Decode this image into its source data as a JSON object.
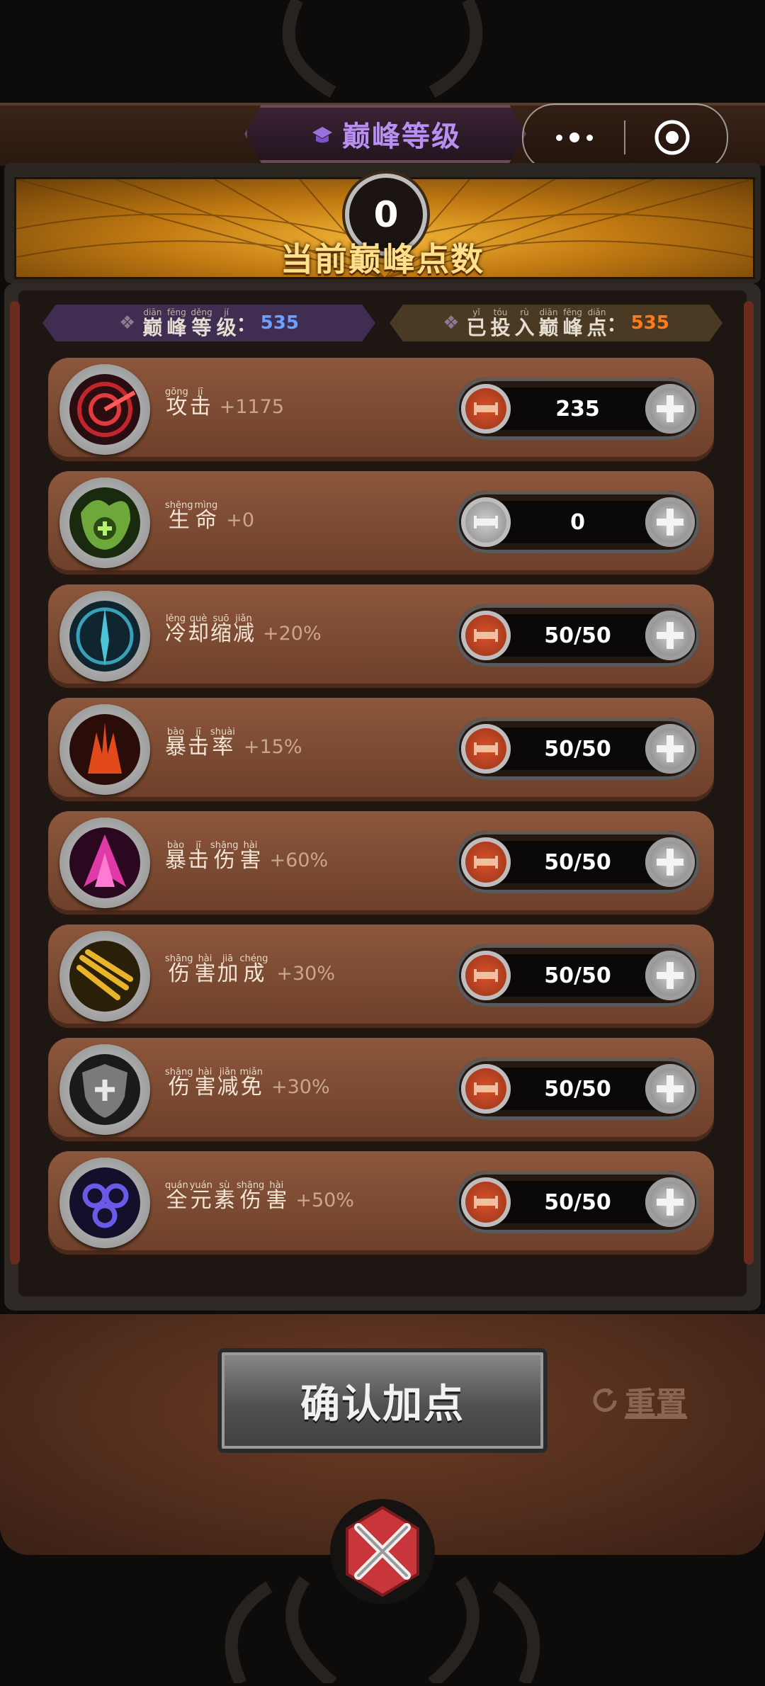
{
  "header": {
    "title": "巅峰等级",
    "title_icon": "peak-hat-icon",
    "capsule": {
      "more_icon": "more-dots-icon",
      "close_icon": "target-close-icon"
    }
  },
  "points": {
    "current": "0",
    "label": "当前巅峰点数"
  },
  "info": {
    "level": {
      "chars": [
        {
          "py": "diān",
          "hz": "巅"
        },
        {
          "py": "fēng",
          "hz": "峰"
        },
        {
          "py": "děng",
          "hz": "等"
        },
        {
          "py": "jí",
          "hz": "级"
        }
      ],
      "value": "535"
    },
    "invested": {
      "chars": [
        {
          "py": "yǐ",
          "hz": "已"
        },
        {
          "py": "tóu",
          "hz": "投"
        },
        {
          "py": "rù",
          "hz": "入"
        },
        {
          "py": "diān",
          "hz": "巅"
        },
        {
          "py": "fēng",
          "hz": "峰"
        },
        {
          "py": "diǎn",
          "hz": "点"
        }
      ],
      "value": "535"
    }
  },
  "stats": [
    {
      "icon": "attack-target-icon",
      "chars": [
        {
          "py": "gōng",
          "hz": "攻"
        },
        {
          "py": "jī",
          "hz": "击"
        }
      ],
      "bonus": "+1175",
      "value": "235",
      "minus_enabled": true
    },
    {
      "icon": "health-heal-icon",
      "chars": [
        {
          "py": "shēng",
          "hz": "生"
        },
        {
          "py": "mìng",
          "hz": "命"
        }
      ],
      "bonus": "+0",
      "value": "0",
      "minus_enabled": false
    },
    {
      "icon": "cooldown-clock-icon",
      "chars": [
        {
          "py": "lěng",
          "hz": "冷"
        },
        {
          "py": "què",
          "hz": "却"
        },
        {
          "py": "suō",
          "hz": "缩"
        },
        {
          "py": "jiǎn",
          "hz": "减"
        }
      ],
      "bonus": "+20%",
      "value": "50/50",
      "minus_enabled": true
    },
    {
      "icon": "crit-rate-flame-icon",
      "chars": [
        {
          "py": "bào",
          "hz": "暴"
        },
        {
          "py": "jī",
          "hz": "击"
        },
        {
          "py": "shuài",
          "hz": "率"
        }
      ],
      "bonus": "+15%",
      "value": "50/50",
      "minus_enabled": true
    },
    {
      "icon": "crit-damage-spike-icon",
      "chars": [
        {
          "py": "bào",
          "hz": "暴"
        },
        {
          "py": "jī",
          "hz": "击"
        },
        {
          "py": "shāng",
          "hz": "伤"
        },
        {
          "py": "hài",
          "hz": "害"
        }
      ],
      "bonus": "+60%",
      "value": "50/50",
      "minus_enabled": true
    },
    {
      "icon": "damage-boost-slash-icon",
      "chars": [
        {
          "py": "shāng",
          "hz": "伤"
        },
        {
          "py": "hài",
          "hz": "害"
        },
        {
          "py": "jiā",
          "hz": "加"
        },
        {
          "py": "chéng",
          "hz": "成"
        }
      ],
      "bonus": "+30%",
      "value": "50/50",
      "minus_enabled": true
    },
    {
      "icon": "damage-reduction-shield-icon",
      "chars": [
        {
          "py": "shāng",
          "hz": "伤"
        },
        {
          "py": "hài",
          "hz": "害"
        },
        {
          "py": "jiǎn",
          "hz": "减"
        },
        {
          "py": "miǎn",
          "hz": "免"
        }
      ],
      "bonus": "+30%",
      "value": "50/50",
      "minus_enabled": true
    },
    {
      "icon": "elemental-damage-orbs-icon",
      "chars": [
        {
          "py": "quán",
          "hz": "全"
        },
        {
          "py": "yuán",
          "hz": "元"
        },
        {
          "py": "sù",
          "hz": "素"
        },
        {
          "py": "shāng",
          "hz": "伤"
        },
        {
          "py": "hài",
          "hz": "害"
        }
      ],
      "bonus": "+50%",
      "value": "50/50",
      "minus_enabled": true
    }
  ],
  "actions": {
    "confirm": "确认加点",
    "reset": "重置",
    "reset_icon": "refresh-icon",
    "close_icon": "crossed-swords-close-icon"
  },
  "colors": {
    "title_purple": "#b98ff2",
    "level_value": "#6aa0ff",
    "invested_value": "#ff7a1a",
    "minus_red": "#d7532b",
    "gold": "#f2b335"
  }
}
